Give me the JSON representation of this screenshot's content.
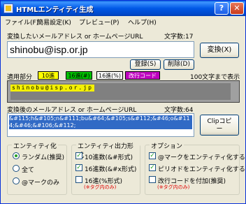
{
  "window": {
    "title": "HTMLエンティティ生成"
  },
  "menu": {
    "items": [
      "ファイル(F)",
      "簡易設定(K)",
      "プレビュー(P)",
      "ヘルプ(H)"
    ]
  },
  "input_section": {
    "label": "変換したいメールアドレス or ホームページURL",
    "char_count": "文字数:17",
    "value": "shinobu@isp.or.jp",
    "convert_button": "変換(X)",
    "register_button": "登録(S)",
    "delete_button": "削除(D)"
  },
  "applied_section": {
    "label": "適用部分",
    "tags": [
      "10進",
      "16進(#)",
      "16進(%)",
      "改行コード"
    ],
    "tag_colors": [
      "#ffff00",
      "#00c000",
      "#ffffff",
      "#c000c0"
    ],
    "display_limit": "100文字まで表示",
    "preview_text": "shinobu@isp.or.jp"
  },
  "output_section": {
    "label": "変換後のメールアドレス or ホームページURL",
    "char_count": "文字数:64",
    "value": "&#115;h&#105;n&#111;bu&#64;&#105;s&#112;&#46;o&#114;&#46;&#106;&#112;",
    "clip_button_line1": "Clipコピ",
    "clip_button_line2": "ー"
  },
  "entity_group": {
    "title": "エンティティ化",
    "options": [
      "ランダム(推奨)",
      "全て",
      "@マークのみ"
    ],
    "selected": 0
  },
  "format_group": {
    "title": "エンティティ出力形式",
    "options": [
      "10進数(&#形式)",
      "16進数(&#x形式)",
      "16進(%形式)"
    ],
    "checked": [
      true,
      true,
      false
    ],
    "note": "(※タグ内のみ)"
  },
  "option_group": {
    "title": "オプション",
    "options": [
      "@マークをエンティティ化する",
      "ピリオドをエンティティ化する",
      "改行コードを付加(推奨)"
    ],
    "checked": [
      true,
      true,
      false
    ],
    "note": "(※タグ内のみ)"
  }
}
